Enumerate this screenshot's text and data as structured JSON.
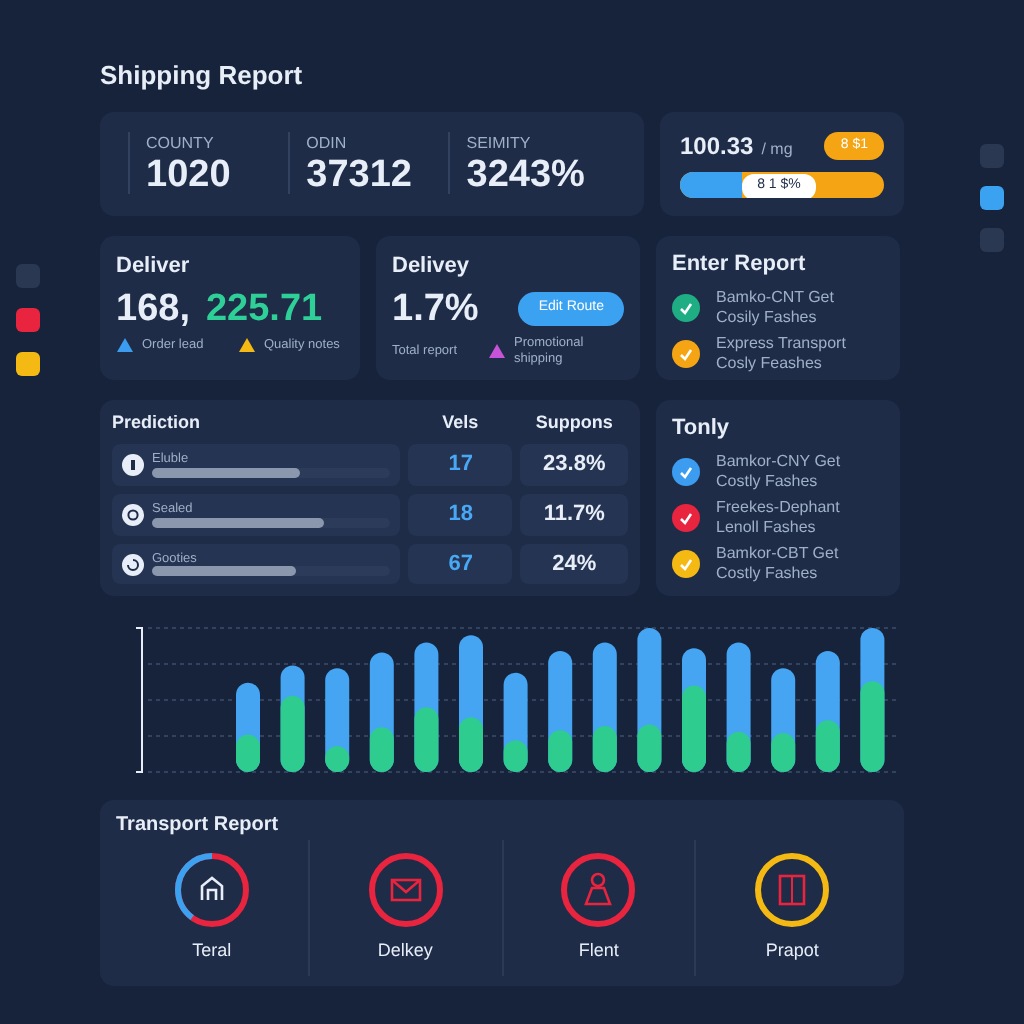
{
  "title": "Shipping Report",
  "side_swatches": [
    {
      "color": "#2a3852"
    },
    {
      "color": "#e8243f"
    },
    {
      "color": "#f5b914"
    }
  ],
  "pager": [
    {
      "selected": false
    },
    {
      "selected": true
    },
    {
      "selected": false
    }
  ],
  "stats": [
    {
      "label": "COUNTY",
      "value": "1020"
    },
    {
      "label": "ODIN",
      "value": "37312"
    },
    {
      "label": "SEIMITY",
      "value": "3243%"
    }
  ],
  "rate_card": {
    "value": "100.33",
    "unit": "/ mg",
    "badge": "8 $1",
    "bar_label": "8 1 $%",
    "level": 0.3
  },
  "deliver_card": {
    "title": "Deliver",
    "value": "168,",
    "value_2": "225.71",
    "legend": [
      {
        "text": "Order lead",
        "color": "#3b9cf0"
      },
      {
        "text": "Quality notes",
        "color": "#f5b914"
      }
    ]
  },
  "delivery_card": {
    "title": "Delivey",
    "value": "1.7%",
    "button": "Edit Route",
    "legend": [
      {
        "text": "Total report"
      },
      {
        "text": "Promotional shipping",
        "color": "#c653d8"
      }
    ]
  },
  "enter_report": {
    "title": "Enter Report",
    "items": [
      {
        "text": "Bamko-CNT Get",
        "sub": "Cosily Fashes",
        "color": "#1fae84"
      },
      {
        "text": "Express Transport",
        "sub": "Cosly Feashes",
        "color": "#f5a514"
      }
    ]
  },
  "table": {
    "columns": [
      "Prediction",
      "Vels",
      "Suppons"
    ],
    "rows": [
      {
        "label": "Eluble",
        "level": 0.62,
        "value": "17",
        "percent": "23.8%"
      },
      {
        "label": "Sealed",
        "level": 0.72,
        "value": "18",
        "percent": "11.7%"
      },
      {
        "label": "Gooties",
        "level": 0.6,
        "value": "67",
        "percent": "24%"
      }
    ]
  },
  "tonly": {
    "title": "Tonly",
    "items": [
      {
        "text": "Bamkor-CNY Get",
        "sub": "Costly Fashes",
        "color": "#3b9cf0"
      },
      {
        "text": "Freekes-Dephant",
        "sub": "Lenoll Fashes",
        "color": "#e8243f"
      },
      {
        "text": "Bamkor-CBT Get",
        "sub": "Costly Fashes",
        "color": "#f5b914"
      }
    ]
  },
  "transport": {
    "title": "Transport Report",
    "items": [
      {
        "label": "Teral",
        "kind": "split",
        "color": "#e8243f"
      },
      {
        "label": "Delkey",
        "kind": "solid",
        "color": "#e8243f"
      },
      {
        "label": "Flent",
        "kind": "solid",
        "color": "#e8243f"
      },
      {
        "label": "Prapot",
        "kind": "solid",
        "color": "#f5b914"
      }
    ]
  }
}
